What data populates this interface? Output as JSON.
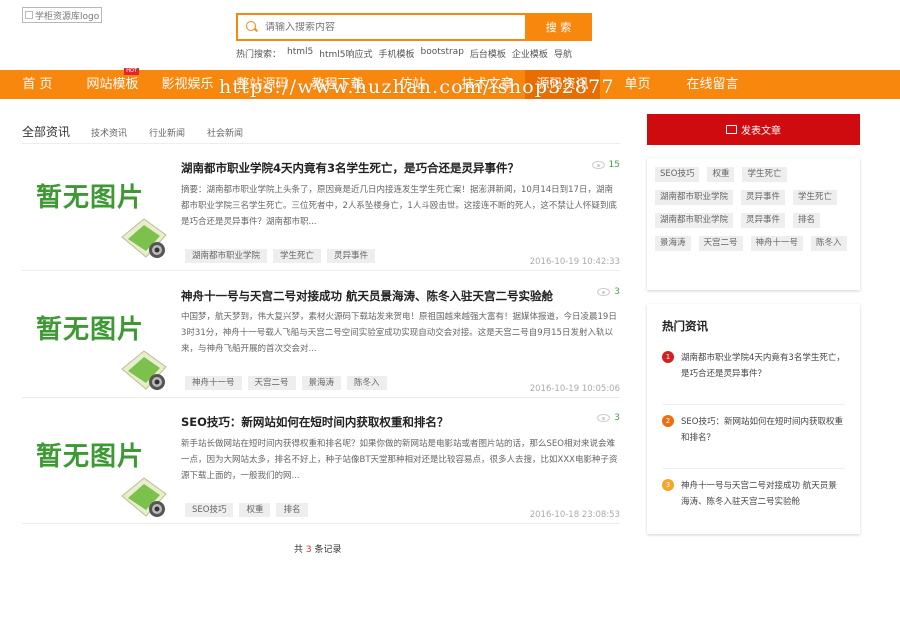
{
  "header": {
    "logo_alt": "学柜资源库logo",
    "search_placeholder": "请输入搜索内容",
    "search_button": "搜 索",
    "hot_label": "热门搜索：",
    "hot_links": [
      "html5",
      "html5响应式",
      "手机模板",
      "bootstrap",
      "后台模板",
      "企业模板",
      "导航"
    ]
  },
  "nav": {
    "items": [
      "首 页",
      "网站模板",
      "影视娱乐",
      "整站源码",
      "教程下载",
      "仿站",
      "技术文章",
      "源码资讯",
      "单页",
      "在线留言"
    ],
    "hot_badge": "HOT",
    "watermark": "https://www.huzhan.com/ishop32877"
  },
  "tabs": [
    "全部资讯",
    "技术资讯",
    "行业新闻",
    "社会新闻"
  ],
  "thumb_text": "暂无图片",
  "articles": [
    {
      "title": "湖南都市职业学院4天内竟有3名学生死亡，是巧合还是灵异事件？",
      "views": "15",
      "summary": "摘要：湖南都市职业学院上头条了，原因竟是近几日内接连发生学生死亡案！据澎湃新闻，10月14日到17日，湖南都市职业学院三名学生死亡。三位死者中，2人系坠楼身亡，1人斗殴击世。这接连不断的死人，这不禁让人怀疑到底是巧合还是灵异事件？湖南都市职...",
      "tags": [
        "湖南都市职业学院",
        "学生死亡",
        "灵异事件"
      ],
      "date": "2016-10-19 10:42:33"
    },
    {
      "title": "神舟十一号与天宫二号对接成功 航天员景海涛、陈冬入驻天宫二号实验舱",
      "views": "3",
      "summary": "中国梦，航天梦到，伟大复兴梦，素材火源码下载站发来贺电！原祖国越来越强大富有！据媒体报道，今日凌晨19日3时31分，神舟十一号载人飞船与天宫二号空间实验室成功实现自动交会对接。这是天宫二号自9月15日发射入轨以来，与神舟飞船开展的首次交会对...",
      "tags": [
        "神舟十一号",
        "天宫二号",
        "景海涛",
        "陈冬入"
      ],
      "date": "2016-10-19 10:05:06"
    },
    {
      "title": "SEO技巧：新网站如何在短时间内获取权重和排名？",
      "views": "3",
      "summary": "新手站长做网站在短时间内获得权重和排名呢？如果你做的新网站是电影站或者图片站的话，那么SEO相对来说会难一点，因为大网站太多，排名不好上，种子站像BT天堂那种相对还是比较容易点，很多人去搜，比如XXX电影种子资源下载上面的，一般我们的网...",
      "tags": [
        "SEO技巧",
        "权重",
        "排名"
      ],
      "date": "2016-10-18 23:08:53"
    }
  ],
  "total": {
    "prefix": "共",
    "count": "3",
    "suffix": "条记录"
  },
  "sidebar": {
    "post_button": "发表文章",
    "tag_cloud": [
      "SEO技巧",
      "权重",
      "学生死亡",
      "湖南都市职业学院",
      "灵异事件",
      "学生死亡",
      "湖南都市职业学院",
      "灵异事件",
      "排名",
      "景海涛",
      "天宫二号",
      "神舟十一号",
      "陈冬入"
    ],
    "hot_title": "热门资讯",
    "hot_items": [
      {
        "rank": "1",
        "text": "湖南都市职业学院4天内竟有3名学生死亡，是巧合还是灵异事件？"
      },
      {
        "rank": "2",
        "text": "SEO技巧：新网站如何在短时间内获取权重和排名？"
      },
      {
        "rank": "3",
        "text": "神舟十一号与天宫二号对接成功 航天员景海涛、陈冬入驻天宫二号实验舱"
      }
    ]
  }
}
